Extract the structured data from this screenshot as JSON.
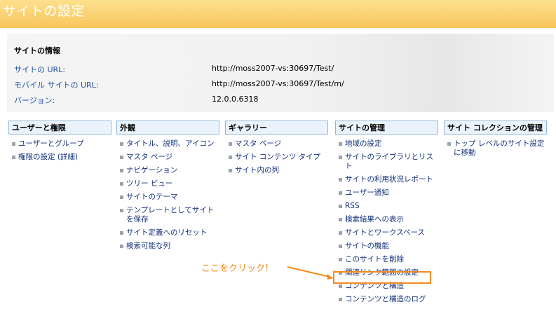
{
  "page_title": "サイトの設定",
  "site_info": {
    "heading": "サイトの情報",
    "rows": [
      {
        "label": "サイトの URL:",
        "value": "http://moss2007-vs:30697/Test/"
      },
      {
        "label": "モバイル サイトの URL:",
        "value": "http://moss2007-vs:30697/Test/m/"
      },
      {
        "label": "バージョン:",
        "value": "12.0.0.6318"
      }
    ]
  },
  "sections": [
    {
      "title": "ユーザーと権限",
      "items": [
        "ユーザーとグループ",
        "権限の設定 (詳細)"
      ]
    },
    {
      "title": "外観",
      "items": [
        "タイトル、説明、アイコン",
        "マスタ ページ",
        "ナビゲーション",
        "ツリー ビュー",
        "サイトのテーマ",
        "テンプレートとしてサイトを保存",
        "サイト定義へのリセット",
        "検索可能な列"
      ]
    },
    {
      "title": "ギャラリー",
      "items": [
        "マスタ ページ",
        "サイト コンテンツ タイプ",
        "サイト内の列"
      ]
    },
    {
      "title": "サイトの管理",
      "items": [
        "地域の設定",
        "サイトのライブラリとリスト",
        "サイトの利用状況レポート",
        "ユーザー通知",
        "RSS",
        "検索結果への表示",
        "サイトとワークスペース",
        "サイトの機能",
        "このサイトを削除",
        "関連リンク範囲の設定",
        "コンテンツと構造",
        "コンテンツと構造のログ"
      ]
    },
    {
      "title": "サイト コレクションの管理",
      "items": [
        "トップ レベルのサイト設定に移動"
      ]
    }
  ],
  "callout": {
    "text": "ここをクリック!",
    "color": "#f38a1d"
  },
  "colors": {
    "title_bar": "#f7c65c",
    "link": "#0f2e7a",
    "info_label": "#2050a8",
    "section_header_bg": "#eaf3fb",
    "section_header_border": "#8fb8d8"
  }
}
